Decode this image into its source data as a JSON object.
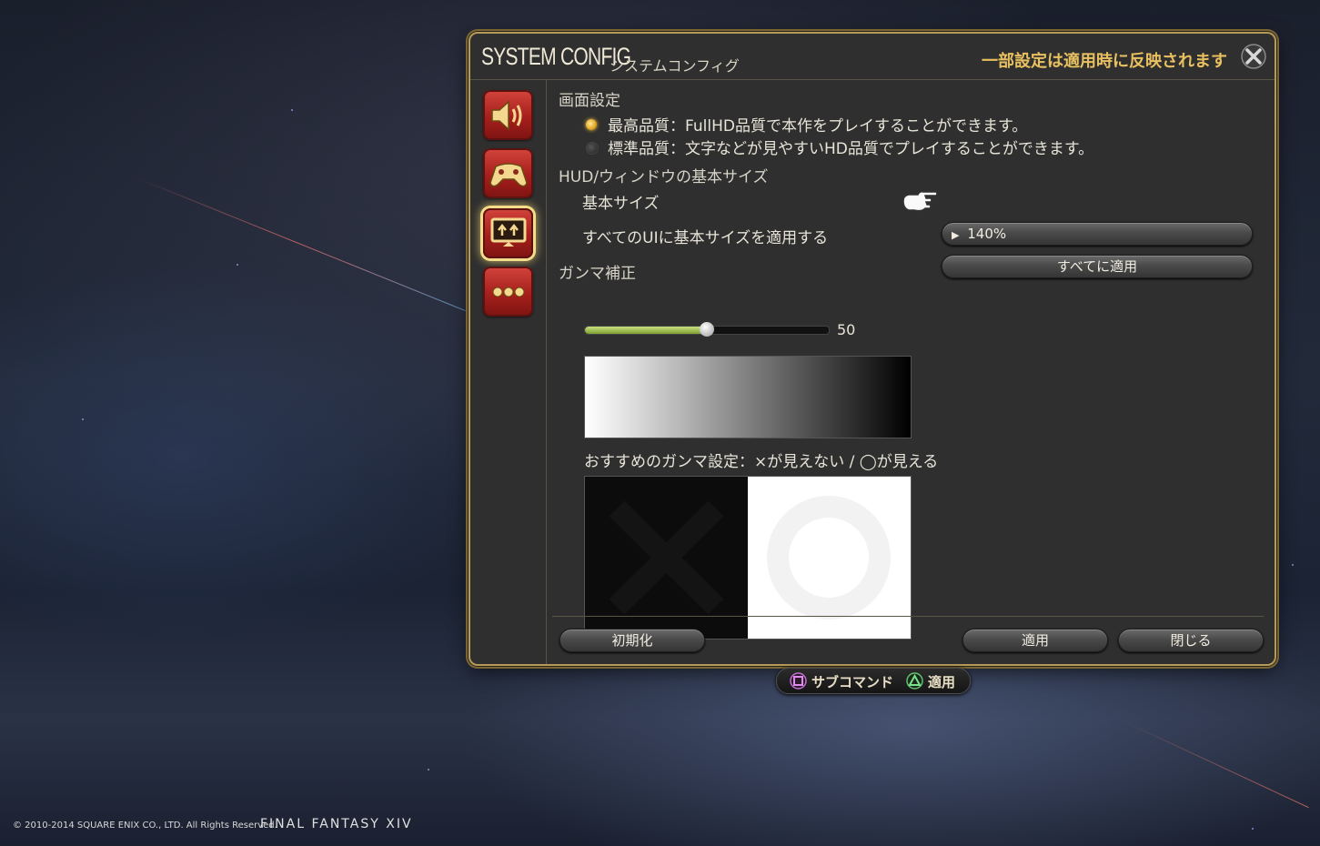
{
  "window": {
    "title": "SYSTEM CONFIG",
    "subtitle": "システムコンフィグ",
    "note": "一部設定は適用時に反映されます"
  },
  "sidebar": {
    "items": [
      {
        "icon": "speaker-icon"
      },
      {
        "icon": "gamepad-icon"
      },
      {
        "icon": "display-settings-icon",
        "active": true
      },
      {
        "icon": "more-icon"
      }
    ]
  },
  "screen_settings": {
    "heading": "画面設定",
    "options": [
      {
        "label": "最高品質：FullHD品質で本作をプレイすることができます。",
        "selected": true
      },
      {
        "label": "標準品質：文字などが見やすいHD品質でプレイすることができます。",
        "selected": false
      }
    ]
  },
  "hud": {
    "heading": "HUD/ウィンドウの基本サイズ",
    "base_size_label": "基本サイズ",
    "base_size_value": "140%",
    "apply_all_label": "すべてのUIに基本サイズを適用する",
    "apply_all_button": "すべてに適用"
  },
  "gamma": {
    "heading": "ガンマ補正",
    "value": 50,
    "value_text": "50",
    "slider_fraction": 0.5,
    "recommend_text": "おすすめのガンマ設定：×が見えない / ◯が見える"
  },
  "footer": {
    "reset_button": "初期化",
    "apply_button": "適用",
    "close_button": "閉じる"
  },
  "hint": {
    "subcommand": "サブコマンド",
    "apply": "適用"
  },
  "copyright": "© 2010-2014 SQUARE ENIX CO., LTD. All Rights Reserved.",
  "logo": "FINAL FANTASY XIV",
  "colors": {
    "accent_gold": "#e8c060",
    "frame_gold": "#b59a5a",
    "sidebar_red": "#a51f1c",
    "slider_green": "#9cc048"
  }
}
